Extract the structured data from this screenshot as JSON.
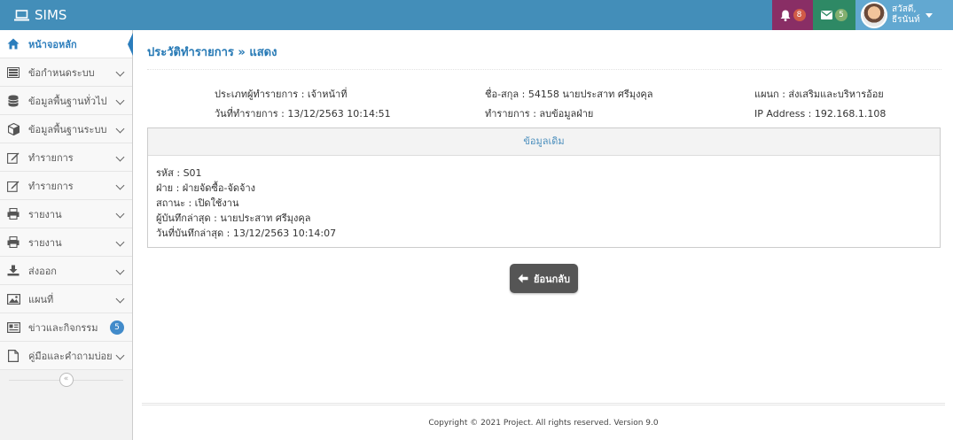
{
  "navbar": {
    "brand": "SIMS",
    "notifications_count": "8",
    "messages_count": "5",
    "user_greeting": "สวัสดี,",
    "user_name": "ธีรนันท์"
  },
  "sidebar": {
    "items": [
      {
        "label": "หน้าจอหลัก",
        "icon": "home-icon"
      },
      {
        "label": "ข้อกำหนดระบบ",
        "icon": "settings-list-icon"
      },
      {
        "label": "ข้อมูลพื้นฐานทั่วไป",
        "icon": "database-icon"
      },
      {
        "label": "ข้อมูลพื้นฐานระบบ",
        "icon": "cube-icon"
      },
      {
        "label": "ทำรายการ",
        "icon": "edit-icon"
      },
      {
        "label": "ทำรายการ",
        "icon": "edit-icon"
      },
      {
        "label": "รายงาน",
        "icon": "print-icon"
      },
      {
        "label": "รายงาน",
        "icon": "print-icon"
      },
      {
        "label": "ส่งออก",
        "icon": "download-icon"
      },
      {
        "label": "แผนที่",
        "icon": "image-icon"
      },
      {
        "label": "ข่าวและกิจกรรม",
        "icon": "newspaper-icon",
        "badge": "5"
      },
      {
        "label": "คู่มือและคำถามบ่อย",
        "icon": "file-icon"
      }
    ]
  },
  "page": {
    "title": "ประวัติทำรายการ » แสดง",
    "info": {
      "type": "ประเภทผู้ทำรายการ : เจ้าหน้าที่",
      "date": "วันที่ทำรายการ : 13/12/2563 10:14:51",
      "name": "ชื่อ-สกุล : 54158  นายประสาท ศรีมุงคุล",
      "action": "ทำรายการ : ลบข้อมูลฝ่าย",
      "department": "แผนก : ส่งเสริมและบริหารอ้อย",
      "ip": "IP Address : 192.168.1.108"
    },
    "panel": {
      "heading": "ข้อมูลเดิม",
      "lines": [
        "รหัส : S01",
        "ฝ่าย : ฝ่ายจัดซื้อ-จัดจ้าง",
        "สถานะ : เปิดใช้งาน",
        "ผู้บันทึกล่าสุด : นายประสาท ศรีมุงคุล",
        "วันที่บันทึกล่าสุด : 13/12/2563 10:14:07"
      ]
    },
    "back_button": "ย้อนกลับ"
  },
  "footer": {
    "text": "Copyright © 2021 Project. All rights reserved. Version 9.0"
  },
  "colors": {
    "navbar": "#438eb9",
    "notif_bg": "#892e65",
    "msg_bg": "#2e8965",
    "user_bg": "#62a8d1",
    "accent": "#2679b5"
  }
}
